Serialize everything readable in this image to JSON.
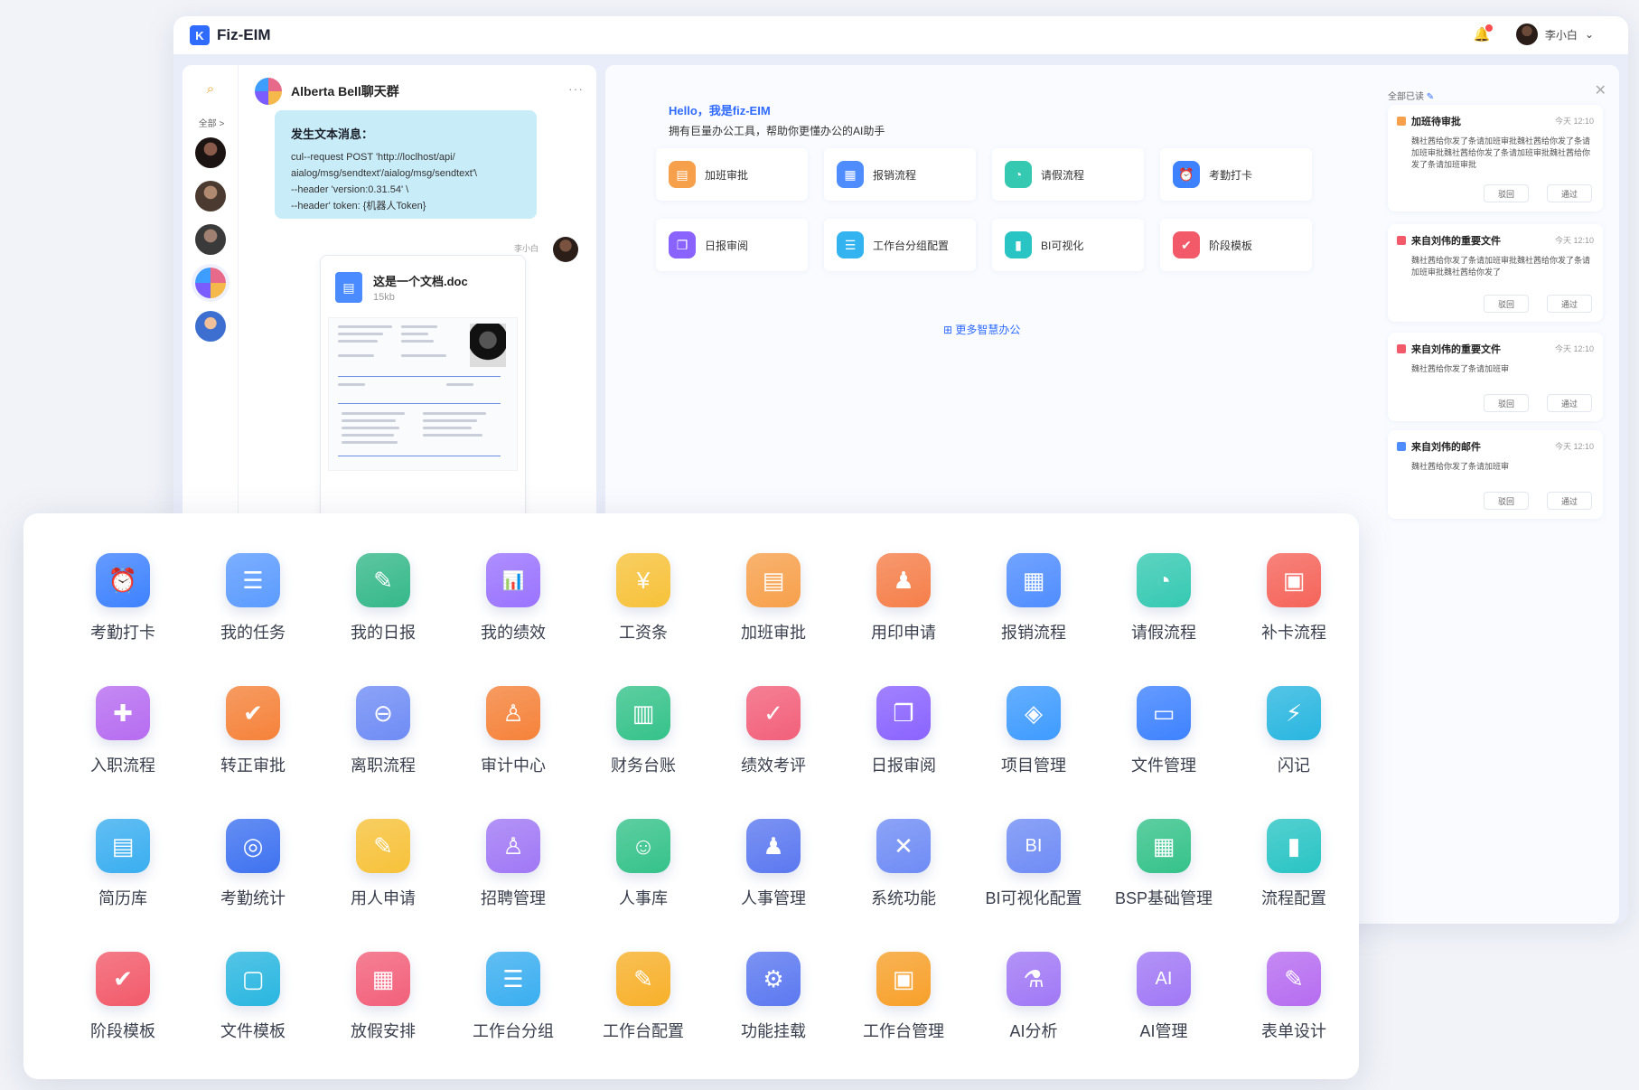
{
  "window": {
    "title": "Fiz-EIM",
    "user_name": "李小白"
  },
  "chat": {
    "all_label": "全部",
    "header": "Alberta Bell聊天群",
    "message": {
      "title": "发生文本消息：",
      "lines": [
        "cul--request POST 'http://loclhost/api/",
        "aialog/msg/sendtext'/aialog/msg/sendtext'\\",
        "--header 'version:0.31.54' \\",
        "--header' token: {机器人Token}"
      ]
    },
    "sender": "李小白",
    "doc": {
      "name": "这是一个文档.doc",
      "size": "15kb"
    }
  },
  "dashboard": {
    "greeting": "Hello，我是fiz-EIM",
    "subtitle": "拥有巨量办公工具，帮助你更懂办公的AI助手",
    "quick": [
      {
        "label": "加班审批",
        "icon": "overtime-icon",
        "color": "#f7a04b"
      },
      {
        "label": "报销流程",
        "icon": "reimburse-icon",
        "color": "#4f8dff"
      },
      {
        "label": "请假流程",
        "icon": "leave-icon",
        "color": "#35c9b2"
      },
      {
        "label": "考勤打卡",
        "icon": "attendance-icon",
        "color": "#3e82ff"
      },
      {
        "label": "日报审阅",
        "icon": "daily-review-icon",
        "color": "#8a63ff"
      },
      {
        "label": "工作台分组配置",
        "icon": "workbench-group-icon",
        "color": "#34b3f1"
      },
      {
        "label": "BI可视化",
        "icon": "bi-icon",
        "color": "#29c4c4"
      },
      {
        "label": "阶段模板",
        "icon": "stage-template-icon",
        "color": "#f25a6a"
      }
    ],
    "more_link": "更多智慧办公",
    "read_all": "全部已读",
    "notices": [
      {
        "title": "加班待审批",
        "time": "今天 12:10",
        "body": "魏社茜给你发了条请加班审批魏社茜给你发了条请加班审批魏社茜给你发了条请加班审批魏社茜给你发了条请加班审批",
        "color": "#f7a04b",
        "reject": "驳回",
        "approve": "通过"
      },
      {
        "title": "来自刘伟的重要文件",
        "time": "今天 12:10",
        "body": "魏社茜给你发了条请加班审批魏社茜给你发了条请加班审批魏社茜给你发了",
        "color": "#f25a6a",
        "reject": "驳回",
        "approve": "通过"
      },
      {
        "title": "来自刘伟的重要文件",
        "time": "今天 12:10",
        "body": "魏社茜给你发了条请加班审",
        "color": "#f25a6a",
        "reject": "驳回",
        "approve": "通过"
      },
      {
        "title": "来自刘伟的邮件",
        "time": "今天 12:10",
        "body": "魏社茜给你发了条请加班审",
        "color": "#4f8dff",
        "reject": "驳回",
        "approve": "通过"
      }
    ]
  },
  "apps": [
    {
      "label": "考勤打卡",
      "icon": "attendance-icon",
      "glyph": "⏰",
      "color": "#3e82ff"
    },
    {
      "label": "我的任务",
      "icon": "task-icon",
      "glyph": "☰",
      "color": "#5b9bff"
    },
    {
      "label": "我的日报",
      "icon": "daily-report-icon",
      "glyph": "✎",
      "color": "#35b88a"
    },
    {
      "label": "我的绩效",
      "icon": "performance-icon",
      "glyph": "📊",
      "color": "#9a73ff"
    },
    {
      "label": "工资条",
      "icon": "payslip-icon",
      "glyph": "¥",
      "color": "#f7c23a"
    },
    {
      "label": "加班审批",
      "icon": "overtime-icon",
      "glyph": "▤",
      "color": "#f7a04b"
    },
    {
      "label": "用印申请",
      "icon": "seal-icon",
      "glyph": "♟",
      "color": "#f57f4a"
    },
    {
      "label": "报销流程",
      "icon": "reimburse-icon",
      "glyph": "▦",
      "color": "#4f8dff"
    },
    {
      "label": "请假流程",
      "icon": "leave-icon",
      "glyph": "◔",
      "color": "#35c9b2"
    },
    {
      "label": "补卡流程",
      "icon": "makeup-icon",
      "glyph": "▣",
      "color": "#f5645a"
    },
    {
      "label": "入职流程",
      "icon": "onboarding-icon",
      "glyph": "✚",
      "color": "#b66cf0"
    },
    {
      "label": "转正审批",
      "icon": "regularization-icon",
      "glyph": "✔",
      "color": "#f5823a"
    },
    {
      "label": "离职流程",
      "icon": "resignation-icon",
      "glyph": "⊖",
      "color": "#6f8cf5"
    },
    {
      "label": "审计中心",
      "icon": "audit-icon",
      "glyph": "♙",
      "color": "#f5823a"
    },
    {
      "label": "财务台账",
      "icon": "finance-icon",
      "glyph": "▥",
      "color": "#35c28a"
    },
    {
      "label": "绩效考评",
      "icon": "evaluation-icon",
      "glyph": "✓",
      "color": "#f2607a"
    },
    {
      "label": "日报审阅",
      "icon": "daily-review-icon",
      "glyph": "❐",
      "color": "#8a63ff"
    },
    {
      "label": "项目管理",
      "icon": "project-icon",
      "glyph": "◈",
      "color": "#3e9bff"
    },
    {
      "label": "文件管理",
      "icon": "folder-icon",
      "glyph": "▭",
      "color": "#3e82ff"
    },
    {
      "label": "闪记",
      "icon": "quick-note-icon",
      "glyph": "⚡",
      "color": "#29b6e0"
    },
    {
      "label": "简历库",
      "icon": "resume-icon",
      "glyph": "▤",
      "color": "#3aaef0"
    },
    {
      "label": "考勤统计",
      "icon": "fingerprint-icon",
      "glyph": "◎",
      "color": "#3e72f0"
    },
    {
      "label": "用人申请",
      "icon": "hiring-request-icon",
      "glyph": "✎",
      "color": "#f7c23a"
    },
    {
      "label": "招聘管理",
      "icon": "recruit-icon",
      "glyph": "♙",
      "color": "#a078f5"
    },
    {
      "label": "人事库",
      "icon": "personnel-icon",
      "glyph": "☺",
      "color": "#35c28a"
    },
    {
      "label": "人事管理",
      "icon": "hr-manage-icon",
      "glyph": "♟",
      "color": "#5b78f0"
    },
    {
      "label": "系统功能",
      "icon": "system-icon",
      "glyph": "✕",
      "color": "#6f8cf5"
    },
    {
      "label": "BI可视化配置",
      "icon": "bi-config-icon",
      "glyph": "BI",
      "color": "#6f8cf5"
    },
    {
      "label": "BSP基础管理",
      "icon": "bsp-icon",
      "glyph": "▦",
      "color": "#35c28a"
    },
    {
      "label": "流程配置",
      "icon": "flow-config-icon",
      "glyph": "▮",
      "color": "#29c4c4"
    },
    {
      "label": "阶段模板",
      "icon": "stage-template-icon",
      "glyph": "✔",
      "color": "#f25a6a"
    },
    {
      "label": "文件模板",
      "icon": "file-template-icon",
      "glyph": "▢",
      "color": "#29b6e0"
    },
    {
      "label": "放假安排",
      "icon": "holiday-icon",
      "glyph": "▦",
      "color": "#f2607a"
    },
    {
      "label": "工作台分组",
      "icon": "workbench-group-icon",
      "glyph": "☰",
      "color": "#3aaef0"
    },
    {
      "label": "工作台配置",
      "icon": "workbench-config-icon",
      "glyph": "✎",
      "color": "#f7b02a"
    },
    {
      "label": "功能挂载",
      "icon": "mount-icon",
      "glyph": "⚙",
      "color": "#5b78f0"
    },
    {
      "label": "工作台管理",
      "icon": "workbench-manage-icon",
      "glyph": "▣",
      "color": "#f7a02a"
    },
    {
      "label": "AI分析",
      "icon": "ai-analysis-icon",
      "glyph": "⚗",
      "color": "#a078f5"
    },
    {
      "label": "AI管理",
      "icon": "ai-manage-icon",
      "glyph": "AI",
      "color": "#a078f5"
    },
    {
      "label": "表单设计",
      "icon": "form-design-icon",
      "glyph": "✎",
      "color": "#b66cf0"
    }
  ]
}
